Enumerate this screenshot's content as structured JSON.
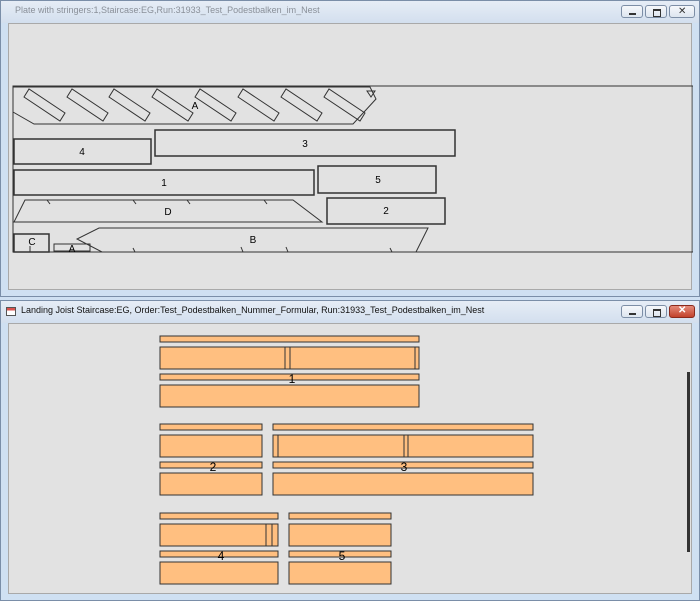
{
  "window1": {
    "title": "Plate with stringers:1,Staircase:EG,Run:31933_Test_Podestbalken_im_Nest",
    "parts": {
      "A": "A",
      "B": "B",
      "C": "C",
      "D": "D",
      "p1": "1",
      "p2": "2",
      "p3": "3",
      "p4": "4",
      "p5": "5",
      "smallA": "A"
    }
  },
  "window2": {
    "title": "Landing Joist Staircase:EG, Order:Test_Podestbalken_Nummer_Formular, Run:31933_Test_Podestbalken_im_Nest",
    "groups": {
      "g1": "1",
      "g2": "2",
      "g3": "3",
      "g4": "4",
      "g5": "5"
    }
  },
  "colors": {
    "piece_fill": "#ffbf80",
    "piece_stroke": "#333333",
    "content_bg": "#e2e2e2"
  },
  "icons": [
    "app-icon",
    "minimize-icon",
    "maximize-icon",
    "close-icon"
  ]
}
